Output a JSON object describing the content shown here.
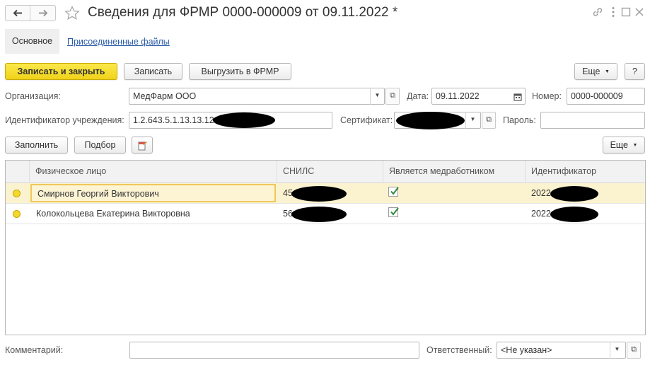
{
  "window": {
    "title": "Сведения для ФРМР 0000-000009 от 09.11.2022 *",
    "nav_back_icon": "arrow-left-icon",
    "nav_forward_icon": "arrow-right-icon",
    "favorite_icon": "star-icon",
    "link_icon": "link-icon",
    "menu_icon": "kebab-menu-icon",
    "maximize_icon": "maximize-icon",
    "close_icon": "close-icon"
  },
  "tabs": {
    "main": "Основное",
    "attached_files": "Присоединенные файлы"
  },
  "toolbar": {
    "save_close": "Записать и закрыть",
    "save": "Записать",
    "export": "Выгрузить в ФРМР",
    "more": "Еще",
    "help": "?"
  },
  "form": {
    "organization_label": "Организация:",
    "organization_value": "МедФарм ООО",
    "date_label": "Дата:",
    "date_value": "09.11.2022",
    "number_label": "Номер:",
    "number_value": "0000-000009",
    "institution_id_label": "Идентификатор учреждения:",
    "institution_id_value": "1.2.643.5.1.13.13.12",
    "certificate_label": "Сертификат:",
    "password_label": "Пароль:",
    "password_value": ""
  },
  "table_toolbar": {
    "fill": "Заполнить",
    "select": "Подбор",
    "more": "Еще"
  },
  "table": {
    "columns": [
      "Физическое лицо",
      "СНИЛС",
      "Является медработником",
      "Идентификатор"
    ],
    "rows": [
      {
        "person": "Смирнов Георгий Викторович",
        "snils": "45",
        "is_medic": true,
        "identifier": "2022"
      },
      {
        "person": "Колокольцева Екатерина Викторовна",
        "snils": "56",
        "is_medic": true,
        "identifier": "2022"
      }
    ]
  },
  "footer": {
    "comment_label": "Комментарий:",
    "comment_value": "",
    "responsible_label": "Ответственный:",
    "responsible_value": "<Не указан>"
  },
  "colors": {
    "accent_yellow": "#f5d82c",
    "link_blue": "#2a5aa8",
    "check_green": "#2e8b3d",
    "selection_bg": "#fbf3cf"
  }
}
